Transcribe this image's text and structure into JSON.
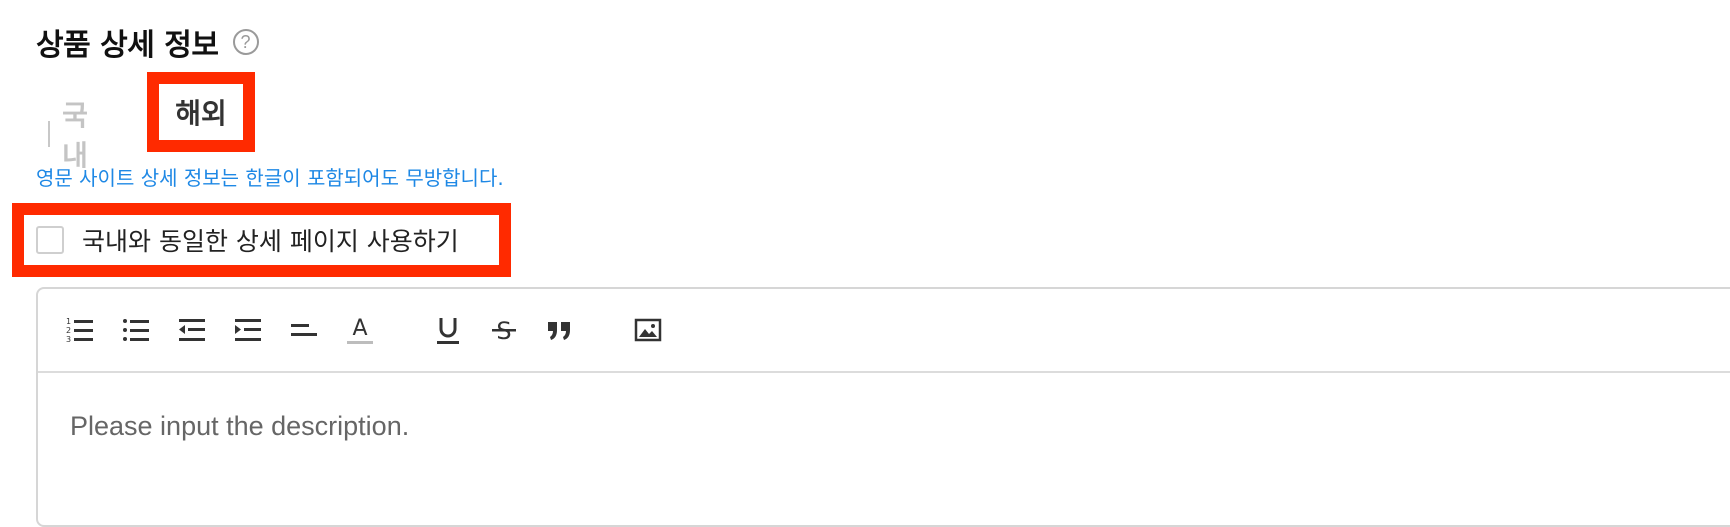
{
  "section": {
    "title": "상품 상세 정보",
    "help_icon": "question-circle-icon",
    "help_glyph": "?"
  },
  "tabs": [
    {
      "label": "국내",
      "active": false
    },
    {
      "label": "해외",
      "active": true
    }
  ],
  "notice": "영문 사이트 상세 정보는 한글이 포함되어도 무방합니다.",
  "same_detail_checkbox": {
    "label": "국내와 동일한 상세 페이지 사용하기",
    "checked": false
  },
  "editor": {
    "toolbar": [
      "ordered-list-icon",
      "bullet-list-icon",
      "outdent-icon",
      "indent-icon",
      "align-left-icon",
      "font-color-icon",
      "underline-icon",
      "strikethrough-icon",
      "blockquote-icon",
      "image-icon"
    ],
    "placeholder": "Please input the description."
  },
  "colors": {
    "highlight": "#ff2a00",
    "notice_text": "#1e88e5",
    "inactive_tab": "#c4c4c4"
  }
}
